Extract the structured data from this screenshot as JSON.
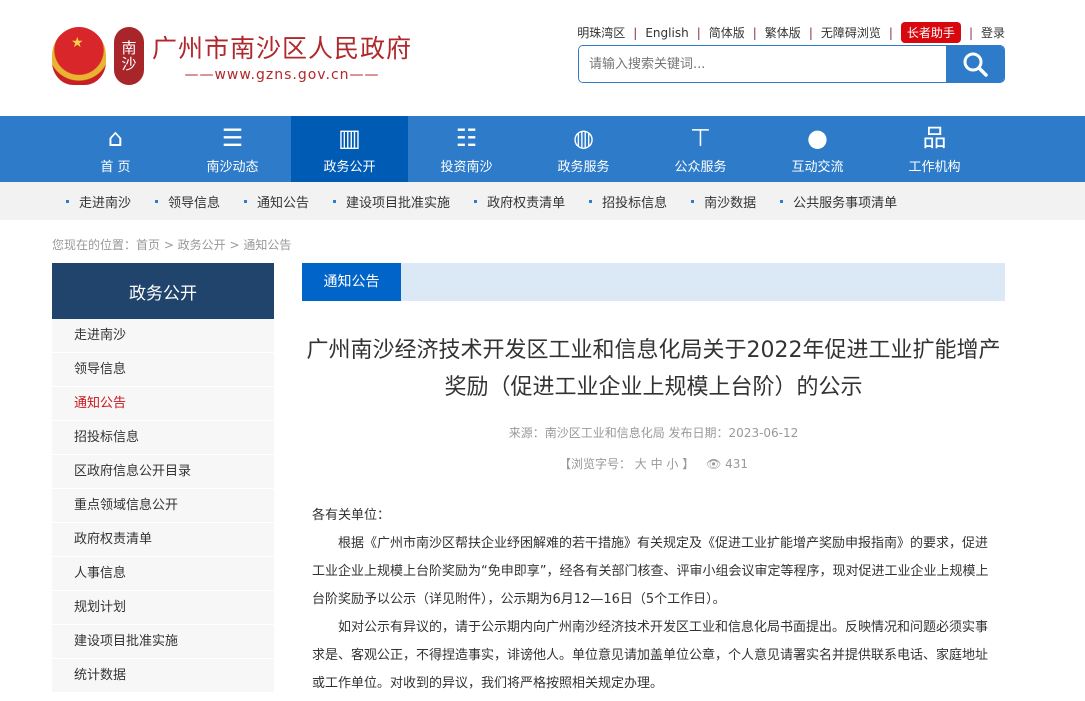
{
  "logo": {
    "title": "广州市南沙区人民政府",
    "url": "——www.gzns.gov.cn——",
    "seal": "南沙"
  },
  "toplinks": [
    "明珠湾区",
    "English",
    "简体版",
    "繁体版",
    "无障碍浏览"
  ],
  "elder": "长者助手",
  "login": "登录",
  "search": {
    "placeholder": "请输入搜索关键词..."
  },
  "nav": [
    {
      "label": "首 页",
      "icon": "home-icon"
    },
    {
      "label": "南沙动态",
      "icon": "list-icon"
    },
    {
      "label": "政务公开",
      "icon": "briefcase-icon"
    },
    {
      "label": "投资南沙",
      "icon": "database-icon"
    },
    {
      "label": "政务服务",
      "icon": "globe-icon"
    },
    {
      "label": "公众服务",
      "icon": "signpost-icon"
    },
    {
      "label": "互动交流",
      "icon": "chat-icon"
    },
    {
      "label": "工作机构",
      "icon": "org-icon"
    }
  ],
  "subnav": [
    "走进南沙",
    "领导信息",
    "通知公告",
    "建设项目批准实施",
    "政府权责清单",
    "招投标信息",
    "南沙数据",
    "公共服务事项清单"
  ],
  "breadcrumb": "您现在的位置：首页 > 政务公开 > 通知公告",
  "sidebar": {
    "title": "政务公开",
    "items": [
      "走进南沙",
      "领导信息",
      "通知公告",
      "招投标信息",
      "区政府信息公开目录",
      "重点领域信息公开",
      "政府权责清单",
      "人事信息",
      "规划计划",
      "建设项目批准实施",
      "统计数据"
    ]
  },
  "main": {
    "tab": "通知公告",
    "title": "广州南沙经济技术开发区工业和信息化局关于2022年促进工业扩能增产奖励（促进工业企业上规模上台阶）的公示",
    "meta": "来源：南沙区工业和信息化局  发布日期：2023-06-12",
    "fontsize": "【浏览字号： 大  中  小 】",
    "views": "431",
    "greeting": "各有关单位：",
    "paragraphs": [
      "根据《广州市南沙区帮扶企业纾困解难的若干措施》有关规定及《促进工业扩能增产奖励申报指南》的要求，促进工业企业上规模上台阶奖励为“免申即享”，经各有关部门核查、评审小组会议审定等程序，现对促进工业企业上规模上台阶奖励予以公示（详见附件），公示期为6月12—16日（5个工作日）。",
      "如对公示有异议的，请于公示期内向广州南沙经济技术开发区工业和信息化局书面提出。反映情况和问题必须实事求是、客观公正，不得捏造事实，诽谤他人。单位意见请加盖单位公章，个人意见请署实名并提供联系电话、家庭地址或工作单位。对收到的异议，我们将严格按照相关规定办理。"
    ]
  }
}
